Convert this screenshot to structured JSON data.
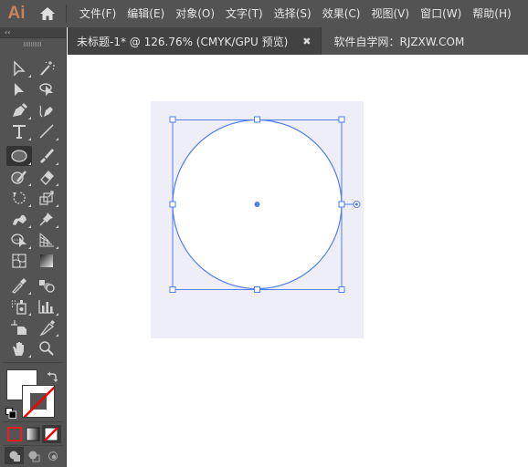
{
  "app": {
    "logo": "Ai"
  },
  "menu": [
    {
      "label": "文件(F)"
    },
    {
      "label": "编辑(E)"
    },
    {
      "label": "对象(O)"
    },
    {
      "label": "文字(T)"
    },
    {
      "label": "选择(S)"
    },
    {
      "label": "效果(C)"
    },
    {
      "label": "视图(V)"
    },
    {
      "label": "窗口(W)"
    },
    {
      "label": "帮助(H)"
    }
  ],
  "toolbar": {
    "collapse_label": "‹‹",
    "tools": [
      {
        "name": "selection-tool"
      },
      {
        "name": "magic-wand-tool"
      },
      {
        "name": "direct-selection-tool"
      },
      {
        "name": "lasso-tool"
      },
      {
        "name": "pen-tool"
      },
      {
        "name": "curvature-tool"
      },
      {
        "name": "type-tool"
      },
      {
        "name": "line-segment-tool"
      },
      {
        "name": "ellipse-tool",
        "active": true
      },
      {
        "name": "paintbrush-tool"
      },
      {
        "name": "shaper-tool"
      },
      {
        "name": "eraser-tool"
      },
      {
        "name": "rotate-tool"
      },
      {
        "name": "scale-tool"
      },
      {
        "name": "warp-tool"
      },
      {
        "name": "puppet-warp-tool"
      },
      {
        "name": "shape-builder-tool"
      },
      {
        "name": "perspective-grid-tool"
      },
      {
        "name": "mesh-tool"
      },
      {
        "name": "gradient-tool"
      },
      {
        "name": "eyedropper-tool"
      },
      {
        "name": "blend-tool"
      },
      {
        "name": "symbol-sprayer-tool"
      },
      {
        "name": "column-graph-tool"
      },
      {
        "name": "artboard-tool"
      },
      {
        "name": "slice-tool"
      },
      {
        "name": "hand-tool"
      },
      {
        "name": "zoom-tool"
      }
    ],
    "fill_color": "#ffffff",
    "stroke_color": "none"
  },
  "tabs": [
    {
      "label": "未标题-1* @ 126.76% (CMYK/GPU 预览)",
      "active": true,
      "close": "✖"
    },
    {
      "label": "软件自学网：RJZXW.COM",
      "active": false
    }
  ],
  "document": {
    "zoom": "126.76%",
    "color_mode": "CMYK/GPU 预览",
    "selection_color": "#4f7ff0",
    "artboard_color": "#eeeef8"
  }
}
